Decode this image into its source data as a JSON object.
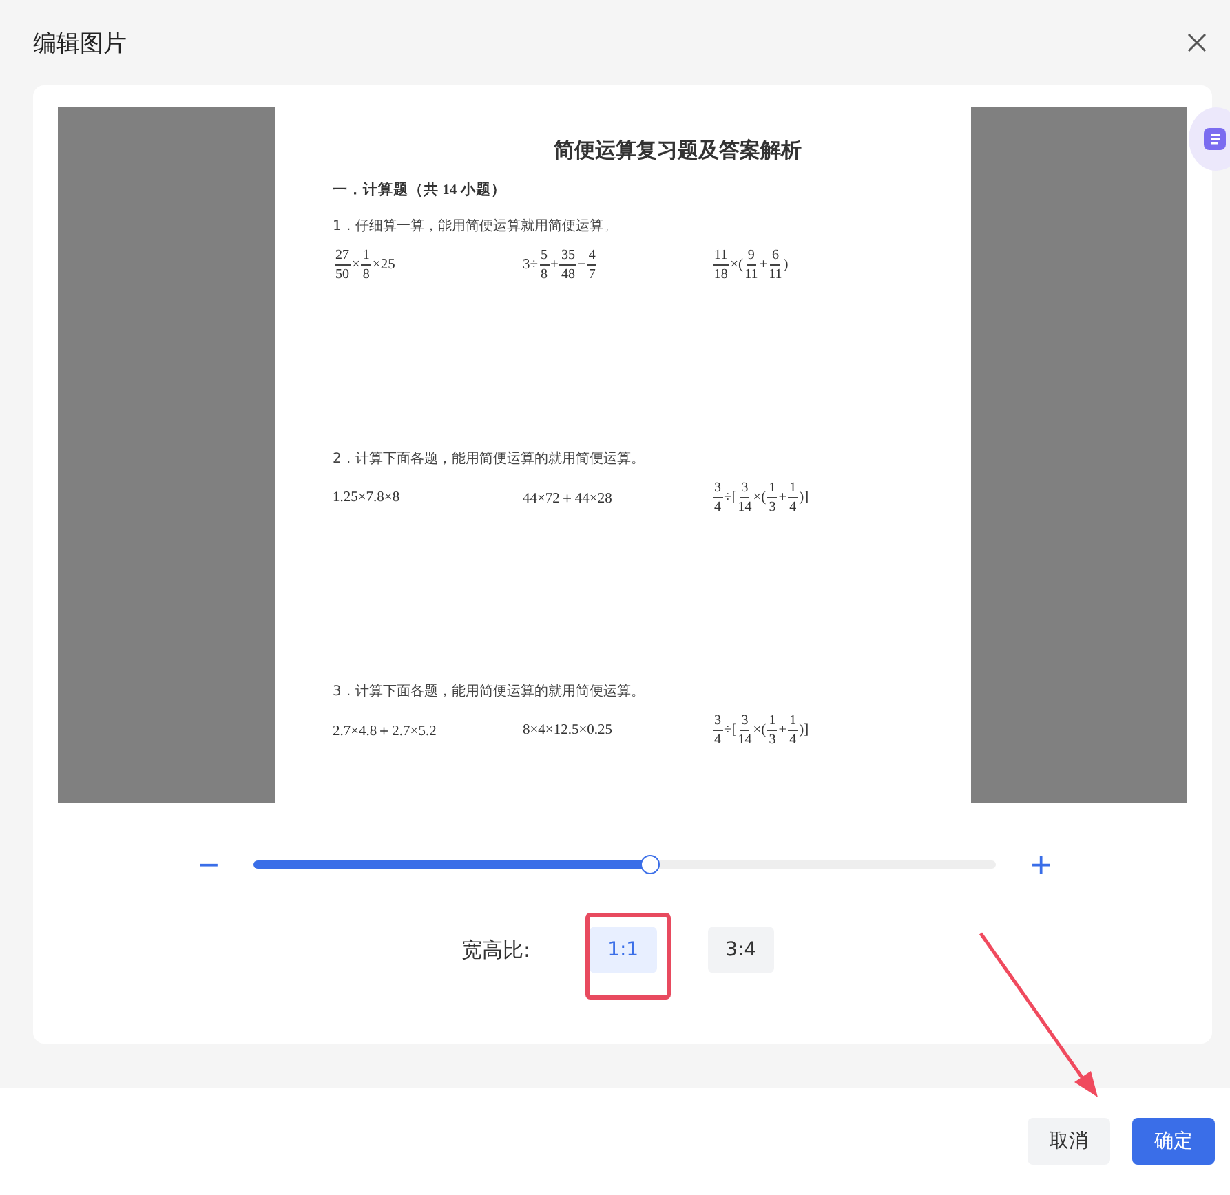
{
  "dialog": {
    "title": "编辑图片"
  },
  "document": {
    "title": "简便运算复习题及答案解析",
    "section": "一．计算题（共 14 小题）",
    "questions": [
      {
        "prompt": "1．仔细算一算，能用简便运算就用简便运算。",
        "expressions": [
          [
            {
              "kind": "frac",
              "num": "27",
              "den": "50"
            },
            {
              "kind": "text",
              "text": "×"
            },
            {
              "kind": "frac",
              "num": "1",
              "den": "8"
            },
            {
              "kind": "text",
              "text": "×25"
            }
          ],
          [
            {
              "kind": "text",
              "text": "3÷"
            },
            {
              "kind": "frac",
              "num": "5",
              "den": "8"
            },
            {
              "kind": "text",
              "text": "+"
            },
            {
              "kind": "frac",
              "num": "35",
              "den": "48"
            },
            {
              "kind": "text",
              "text": "−"
            },
            {
              "kind": "frac",
              "num": "4",
              "den": "7"
            }
          ],
          [
            {
              "kind": "frac",
              "num": "11",
              "den": "18"
            },
            {
              "kind": "text",
              "text": "×("
            },
            {
              "kind": "frac",
              "num": "9",
              "den": "11"
            },
            {
              "kind": "text",
              "text": "+"
            },
            {
              "kind": "frac",
              "num": "6",
              "den": "11"
            },
            {
              "kind": "text",
              "text": ")"
            }
          ]
        ]
      },
      {
        "prompt": "2．计算下面各题，能用简便运算的就用简便运算。",
        "expressions": [
          [
            {
              "kind": "text",
              "text": "1.25×7.8×8"
            }
          ],
          [
            {
              "kind": "text",
              "text": "44×72＋44×28"
            }
          ],
          [
            {
              "kind": "frac",
              "num": "3",
              "den": "4"
            },
            {
              "kind": "text",
              "text": "÷["
            },
            {
              "kind": "frac",
              "num": "3",
              "den": "14"
            },
            {
              "kind": "text",
              "text": "×("
            },
            {
              "kind": "frac",
              "num": "1",
              "den": "3"
            },
            {
              "kind": "text",
              "text": "+"
            },
            {
              "kind": "frac",
              "num": "1",
              "den": "4"
            },
            {
              "kind": "text",
              "text": ")]"
            }
          ]
        ]
      },
      {
        "prompt": "3．计算下面各题，能用简便运算的就用简便运算。",
        "expressions": [
          [
            {
              "kind": "text",
              "text": "2.7×4.8＋2.7×5.2"
            }
          ],
          [
            {
              "kind": "text",
              "text": "8×4×12.5×0.25"
            }
          ],
          [
            {
              "kind": "frac",
              "num": "3",
              "den": "4"
            },
            {
              "kind": "text",
              "text": "÷["
            },
            {
              "kind": "frac",
              "num": "3",
              "den": "14"
            },
            {
              "kind": "text",
              "text": "×("
            },
            {
              "kind": "frac",
              "num": "1",
              "den": "3"
            },
            {
              "kind": "text",
              "text": "+"
            },
            {
              "kind": "frac",
              "num": "1",
              "den": "4"
            },
            {
              "kind": "text",
              "text": ")]"
            }
          ]
        ]
      }
    ]
  },
  "zoom": {
    "minus": "−",
    "plus": "+",
    "level": 0.534
  },
  "aspect_ratio": {
    "label": "宽高比:",
    "options": [
      {
        "label": "1:1",
        "selected": true
      },
      {
        "label": "3:4",
        "selected": false
      }
    ]
  },
  "annotations": {
    "highlight_box": true,
    "pointer_arrow": true
  },
  "buttons": [
    {
      "label": "取消",
      "kind": "secondary"
    },
    {
      "label": "确定",
      "kind": "primary"
    }
  ]
}
